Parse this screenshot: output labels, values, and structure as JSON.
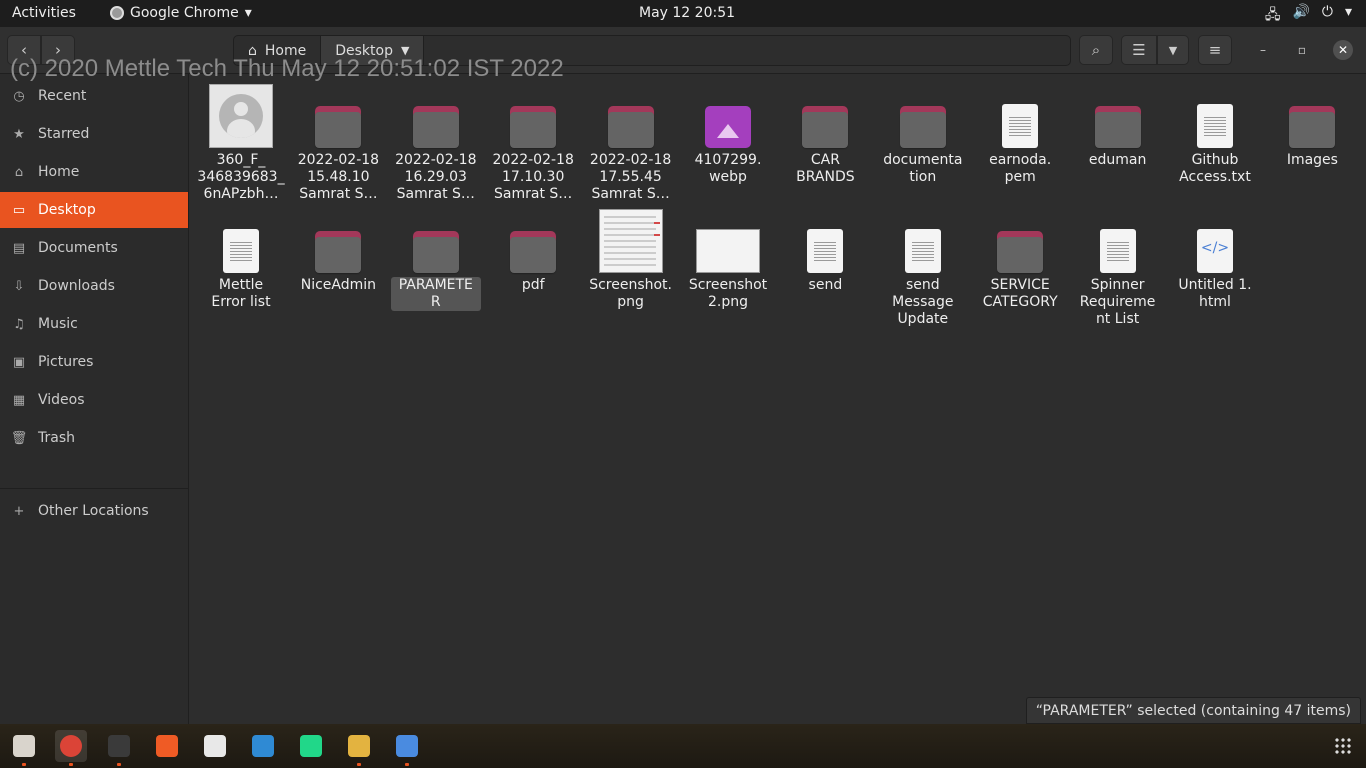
{
  "topbar": {
    "activities": "Activities",
    "app_name": "Google Chrome",
    "app_menu_arrow": "▾",
    "clock": "May 12  20:51",
    "tray_icons": [
      "network-icon",
      "volume-icon",
      "power-icon",
      "power-menu-arrow"
    ]
  },
  "window": {
    "watermark": "(c) 2020 Mettle Tech Thu May 12 20:51:02 IST 2022",
    "path": [
      {
        "label": "Home",
        "icon": "home-icon"
      },
      {
        "label": "Desktop",
        "icon": "chevron-down-icon"
      }
    ]
  },
  "sidebar": {
    "items": [
      {
        "label": "Recent",
        "icon": "clock-icon"
      },
      {
        "label": "Starred",
        "icon": "star-icon"
      },
      {
        "label": "Home",
        "icon": "home-icon"
      },
      {
        "label": "Desktop",
        "icon": "desktop-icon",
        "selected": true
      },
      {
        "label": "Documents",
        "icon": "documents-icon"
      },
      {
        "label": "Downloads",
        "icon": "downloads-icon"
      },
      {
        "label": "Music",
        "icon": "music-icon"
      },
      {
        "label": "Pictures",
        "icon": "pictures-icon"
      },
      {
        "label": "Videos",
        "icon": "videos-icon"
      },
      {
        "label": "Trash",
        "icon": "trash-icon"
      }
    ],
    "other_locations": "Other Locations"
  },
  "files": [
    {
      "name": "360_F_\n346839683_\n6nAPzbh…",
      "type": "avatar-image"
    },
    {
      "name": "2022-02-18\n15.48.10\nSamrat S…",
      "type": "folder"
    },
    {
      "name": "2022-02-18\n16.29.03\nSamrat S…",
      "type": "folder"
    },
    {
      "name": "2022-02-18\n17.10.30\nSamrat S…",
      "type": "folder"
    },
    {
      "name": "2022-02-18\n17.55.45\nSamrat S…",
      "type": "folder"
    },
    {
      "name": "4107299.\nwebp",
      "type": "image"
    },
    {
      "name": "CAR\nBRANDS",
      "type": "folder"
    },
    {
      "name": "documenta\ntion",
      "type": "folder"
    },
    {
      "name": "earnoda.\npem",
      "type": "text"
    },
    {
      "name": "eduman",
      "type": "folder"
    },
    {
      "name": "Github\nAccess.txt",
      "type": "text"
    },
    {
      "name": "Images",
      "type": "folder"
    },
    {
      "name": "Mettle\nError list",
      "type": "text"
    },
    {
      "name": "NiceAdmin",
      "type": "folder"
    },
    {
      "name": "PARAMETE\nR",
      "type": "folder",
      "selected": true
    },
    {
      "name": "pdf",
      "type": "folder"
    },
    {
      "name": "Screenshot.\npng",
      "type": "screenshot"
    },
    {
      "name": "Screenshot\n2.png",
      "type": "screenshot2"
    },
    {
      "name": "send",
      "type": "text"
    },
    {
      "name": "send\nMessage\nUpdate",
      "type": "text"
    },
    {
      "name": "SERVICE\nCATEGORY",
      "type": "folder"
    },
    {
      "name": "Spinner\nRequireme\nnt List",
      "type": "text"
    },
    {
      "name": "Untitled 1.\nhtml",
      "type": "code"
    }
  ],
  "status": "“PARAMETER” selected  (containing 47 items)",
  "dock": [
    {
      "name": "files-dock-icon",
      "color": "#d9d4cc",
      "running": true
    },
    {
      "name": "chrome-dock-icon",
      "color": "#db4437",
      "running": true,
      "active": true
    },
    {
      "name": "terminal-dock-icon",
      "color": "#3a3a3a",
      "running": true
    },
    {
      "name": "postman-dock-icon",
      "color": "#ef5b25",
      "running": false
    },
    {
      "name": "settings-dock-icon",
      "color": "#e8e8e8",
      "running": false
    },
    {
      "name": "vscode-dock-icon",
      "color": "#2f8ad4",
      "running": false
    },
    {
      "name": "pycharm-dock-icon",
      "color": "#21d789",
      "running": false
    },
    {
      "name": "slack-dock-icon",
      "color": "#e3b340",
      "running": true
    },
    {
      "name": "text-editor-dock-icon",
      "color": "#4a8be0",
      "running": true
    }
  ],
  "colors": {
    "accent": "#e95420",
    "folder_tab": "#a3385a",
    "folder_body": "#646464"
  }
}
